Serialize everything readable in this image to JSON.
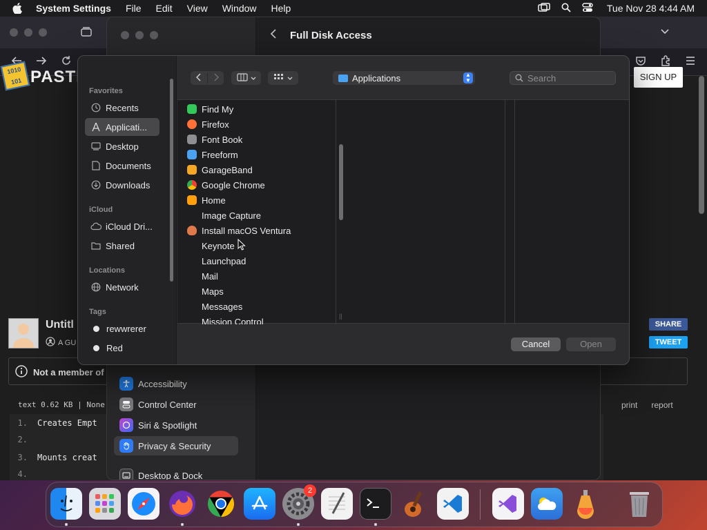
{
  "menubar": {
    "app_name": "System Settings",
    "menus": [
      "File",
      "Edit",
      "View",
      "Window",
      "Help"
    ],
    "clock": "Tue Nov 28  4:44 AM"
  },
  "browser": {
    "logo_badge": "1010 101",
    "logo_text": "PASTE",
    "signup_label": "SIGN UP",
    "paste_title": "Untitl",
    "guest_label": "A GU",
    "share_label": "SHARE",
    "tweet_label": "TWEET",
    "notice_text": "Not a member of",
    "code_meta": "text  0.62 KB | None",
    "code_links": [
      "print",
      "report"
    ],
    "code_lines": [
      {
        "num": "1.",
        "text": "Creates Empt"
      },
      {
        "num": "2.",
        "text": ""
      },
      {
        "num": "3.",
        "text": "Mounts creat"
      },
      {
        "num": "4.",
        "text": ""
      }
    ]
  },
  "settings": {
    "header_title": "Full Disk Access",
    "sidebar_items": [
      {
        "label": "Accessibility",
        "color": "#1f7ae0"
      },
      {
        "label": "Control Center",
        "color": "#7a7a7e"
      },
      {
        "label": "Siri & Spotlight",
        "color": "#c344d0"
      },
      {
        "label": "Privacy & Security",
        "color": "#2f7bf5"
      },
      {
        "label": "Desktop & Dock",
        "color": "#3a3a3c"
      }
    ]
  },
  "panel": {
    "location": "Applications",
    "search_placeholder": "Search",
    "sections": {
      "favorites": "Favorites",
      "icloud": "iCloud",
      "locations": "Locations",
      "tags": "Tags"
    },
    "favorites": [
      "Recents",
      "Applicati...",
      "Desktop",
      "Documents",
      "Downloads"
    ],
    "icloud": [
      "iCloud Dri...",
      "Shared"
    ],
    "locations": [
      "Network"
    ],
    "tags": [
      "rewwrerer",
      "Red"
    ],
    "apps": [
      {
        "name": "Find My",
        "color": "#34c759"
      },
      {
        "name": "Firefox",
        "color": "#ff7139"
      },
      {
        "name": "Font Book",
        "color": "#8e8e93"
      },
      {
        "name": "Freeform",
        "color": "#4aa3f0"
      },
      {
        "name": "GarageBand",
        "color": "#f5a623"
      },
      {
        "name": "Google Chrome",
        "color": "#34a853"
      },
      {
        "name": "Home",
        "color": "#ff9f0a"
      },
      {
        "name": "Image Capture",
        "color": ""
      },
      {
        "name": "Install macOS Ventura",
        "color": "#e0794a"
      },
      {
        "name": "Keynote",
        "color": ""
      },
      {
        "name": "Launchpad",
        "color": ""
      },
      {
        "name": "Mail",
        "color": ""
      },
      {
        "name": "Maps",
        "color": ""
      },
      {
        "name": "Messages",
        "color": ""
      },
      {
        "name": "Mission Control",
        "color": ""
      }
    ],
    "cancel_label": "Cancel",
    "open_label": "Open"
  },
  "dock": {
    "badge_count": "2",
    "apps": [
      {
        "name": "finder-icon",
        "bg": "#1e88f0"
      },
      {
        "name": "launchpad-icon",
        "bg": "#d9d9de"
      },
      {
        "name": "safari-icon",
        "bg": "#f4f4f6"
      },
      {
        "name": "firefox-icon",
        "bg": "#6b2fb3"
      },
      {
        "name": "chrome-icon",
        "bg": "#f4f4f6"
      },
      {
        "name": "app-store-icon",
        "bg": "#1a8cff"
      },
      {
        "name": "system-settings-icon",
        "bg": "#8a8a8f"
      },
      {
        "name": "textedit-icon",
        "bg": "#f2f2f2"
      },
      {
        "name": "terminal-icon",
        "bg": "#1c1c1e"
      },
      {
        "name": "garageband-icon",
        "bg": "#3a2a1a"
      },
      {
        "name": "vscode-icon",
        "bg": "#f2f2f2"
      },
      {
        "name": "visual-studio-icon",
        "bg": "#f4f4f6"
      },
      {
        "name": "weather-icon",
        "bg": "#3fa0f0"
      },
      {
        "name": "migration-icon",
        "bg": "#f4a53a"
      },
      {
        "name": "trash-icon",
        "bg": "transparent"
      }
    ]
  }
}
